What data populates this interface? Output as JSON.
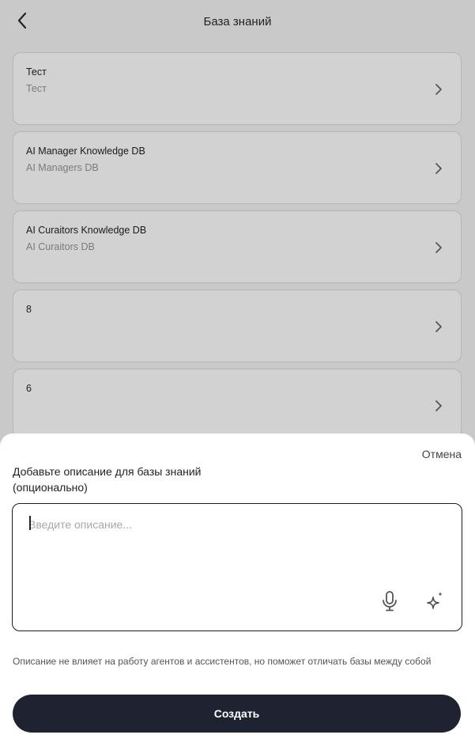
{
  "header": {
    "title": "База знаний"
  },
  "knowledge_bases": [
    {
      "name": "Тест",
      "description": "Тест"
    },
    {
      "name": "AI Manager Knowledge DB",
      "description": "AI Managers DB"
    },
    {
      "name": "AI Curaitors Knowledge DB",
      "description": "AI Curaitors DB"
    },
    {
      "name": "8",
      "description": ""
    },
    {
      "name": "6",
      "description": ""
    }
  ],
  "sheet": {
    "cancel_label": "Отмена",
    "label": "Добавьте описание для базы знаний (опционально)",
    "description_value": "",
    "description_placeholder": "Введите описание...",
    "hint": "Описание не влияет на работу  агентов и ассистентов, но поможет отличать базы между собой",
    "create_label": "Создать"
  },
  "icons": {
    "back": "chevron-left-icon",
    "chevron": "chevron-right-icon",
    "mic": "microphone-icon",
    "ai": "sparkle-icon"
  }
}
